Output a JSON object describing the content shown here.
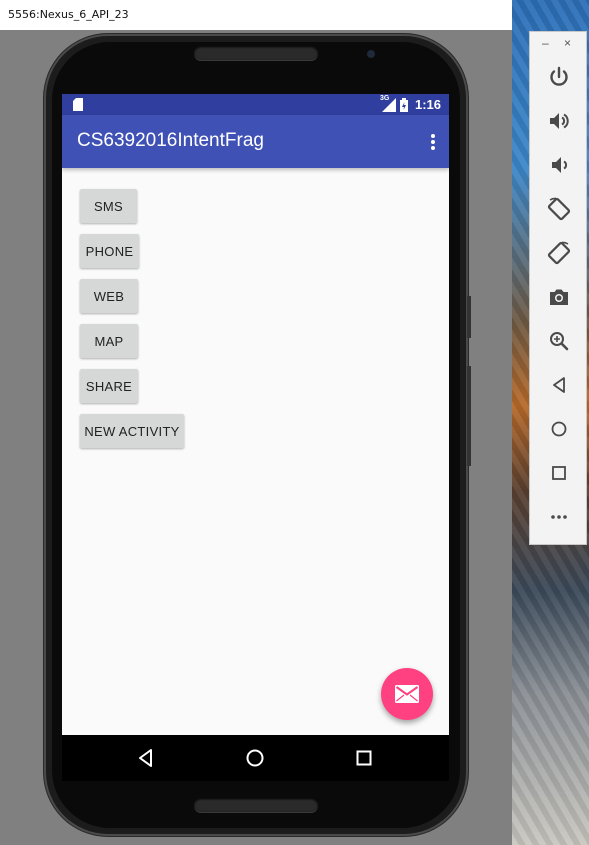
{
  "window": {
    "title": "5556:Nexus_6_API_23"
  },
  "status_bar": {
    "network": "3G",
    "time": "1:16"
  },
  "app_bar": {
    "title": "CS6392016IntentFrag"
  },
  "buttons": [
    {
      "label": "SMS"
    },
    {
      "label": "PHONE"
    },
    {
      "label": "WEB"
    },
    {
      "label": "MAP"
    },
    {
      "label": "SHARE"
    },
    {
      "label": "NEW ACTIVITY"
    }
  ],
  "fab": {
    "icon": "email-icon",
    "color": "#ff4081"
  },
  "colors": {
    "primary": "#3f51b5",
    "primary_dark": "#303f9f",
    "accent": "#ff4081"
  },
  "toolbar": {
    "minimize": "–",
    "close": "×",
    "icons": [
      "power-icon",
      "volume-up-icon",
      "volume-down-icon",
      "rotate-left-icon",
      "rotate-right-icon",
      "camera-icon",
      "zoom-icon",
      "back-icon",
      "home-icon",
      "overview-icon",
      "more-icon"
    ]
  },
  "nav_bar": {
    "icons": [
      "back-icon",
      "home-icon",
      "recents-icon"
    ]
  }
}
